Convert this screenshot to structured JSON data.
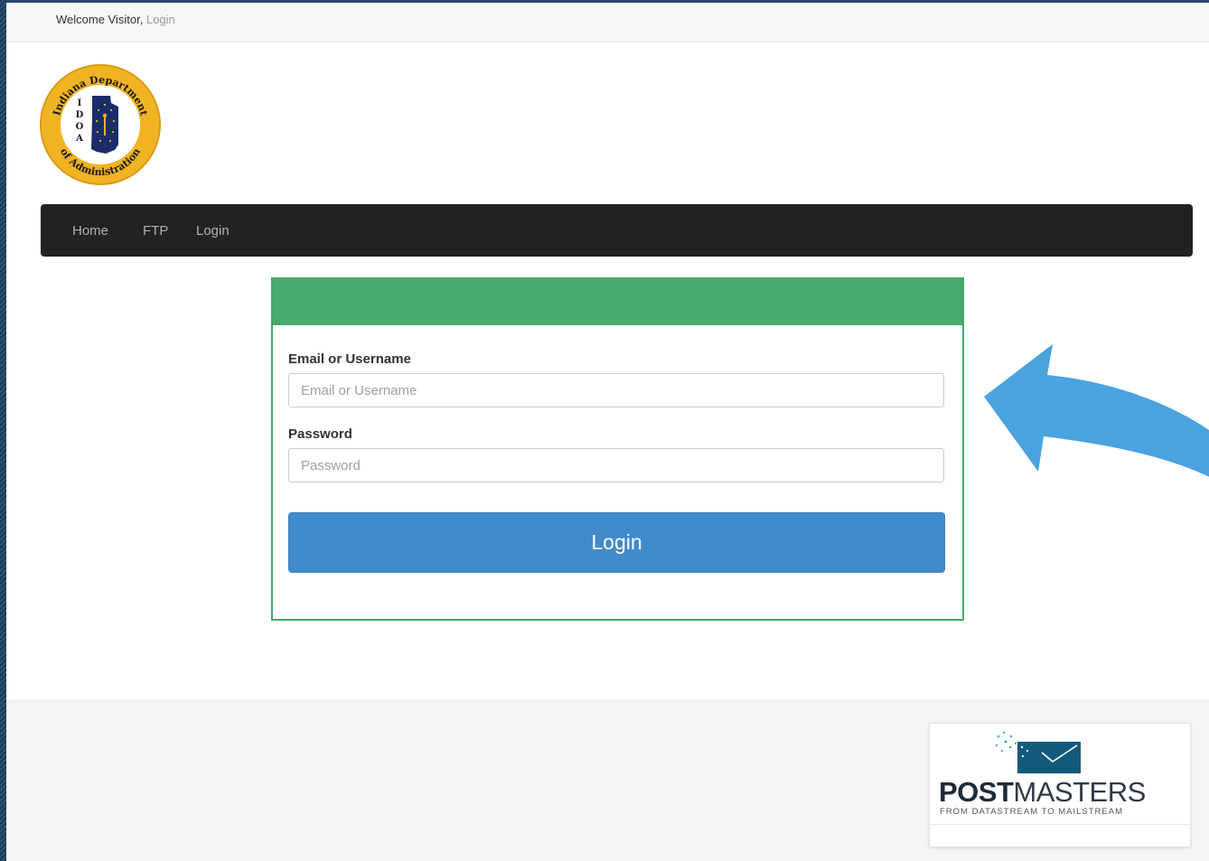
{
  "topbar": {
    "welcome_text": "Welcome Visitor,",
    "login_link": "Login"
  },
  "logo": {
    "top_text": "Indiana Department",
    "bottom_text": "of Administration",
    "letters": [
      "I",
      "D",
      "O",
      "A"
    ],
    "ring_color": "#f0b323"
  },
  "navbar": {
    "items": [
      {
        "label": "Home"
      },
      {
        "label": "FTP"
      },
      {
        "label": "Login"
      }
    ]
  },
  "login_form": {
    "header_color": "#46ab6a",
    "email_label": "Email or Username",
    "email_placeholder": "Email or Username",
    "email_value": "",
    "password_label": "Password",
    "password_placeholder": "Password",
    "password_value": "",
    "submit_label": "Login"
  },
  "annotation": {
    "arrow_color": "#4aa3df",
    "icon": "pointing-arrow-icon"
  },
  "footer": {
    "brand_bold": "POST",
    "brand_rest": "MASTERS",
    "tagline": "FROM DATASTREAM TO MAILSTREAM"
  }
}
